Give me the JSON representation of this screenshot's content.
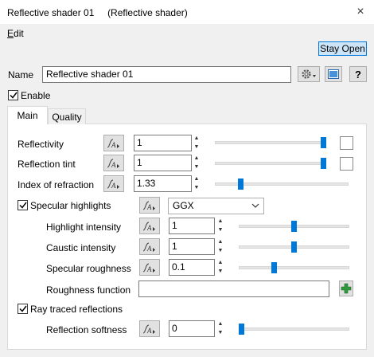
{
  "window": {
    "title": "Reflective shader 01     (Reflective shader)",
    "close_glyph": "×"
  },
  "menu": {
    "edit_underlined": "E",
    "edit_rest": "dit"
  },
  "stay_open": "Stay Open",
  "name": {
    "label": "Name",
    "value": "Reflective shader 01"
  },
  "help_label": "?",
  "enable": {
    "label": "Enable",
    "checked": true
  },
  "tabs": {
    "main": "Main",
    "quality": "Quality",
    "active": "Main"
  },
  "rows": {
    "reflectivity": {
      "label": "Reflectivity",
      "value": "1",
      "slider_fraction": 1.0
    },
    "reflection_tint": {
      "label": "Reflection tint",
      "value": "1",
      "slider_fraction": 1.0
    },
    "index_of_refraction": {
      "label": "Index of refraction",
      "value": "1.33",
      "slider_fraction": 0.12
    },
    "specular_highlights": {
      "label": "Specular highlights",
      "checked": true,
      "model": "GGX"
    },
    "highlight_intensity": {
      "label": "Highlight intensity",
      "value": "1",
      "slider_fraction": 0.5
    },
    "caustic_intensity": {
      "label": "Caustic intensity",
      "value": "1",
      "slider_fraction": 0.5
    },
    "specular_roughness": {
      "label": "Specular roughness",
      "value": "0.1",
      "slider_fraction": 0.3
    },
    "roughness_function": {
      "label": "Roughness function",
      "value": ""
    },
    "ray_traced_reflections": {
      "label": "Ray traced reflections",
      "checked": true
    },
    "reflection_softness": {
      "label": "Reflection softness",
      "value": "0",
      "slider_fraction": 0.0
    }
  },
  "colors": {
    "accent": "#0078d7",
    "highlight_bg": "#cce4f7"
  }
}
